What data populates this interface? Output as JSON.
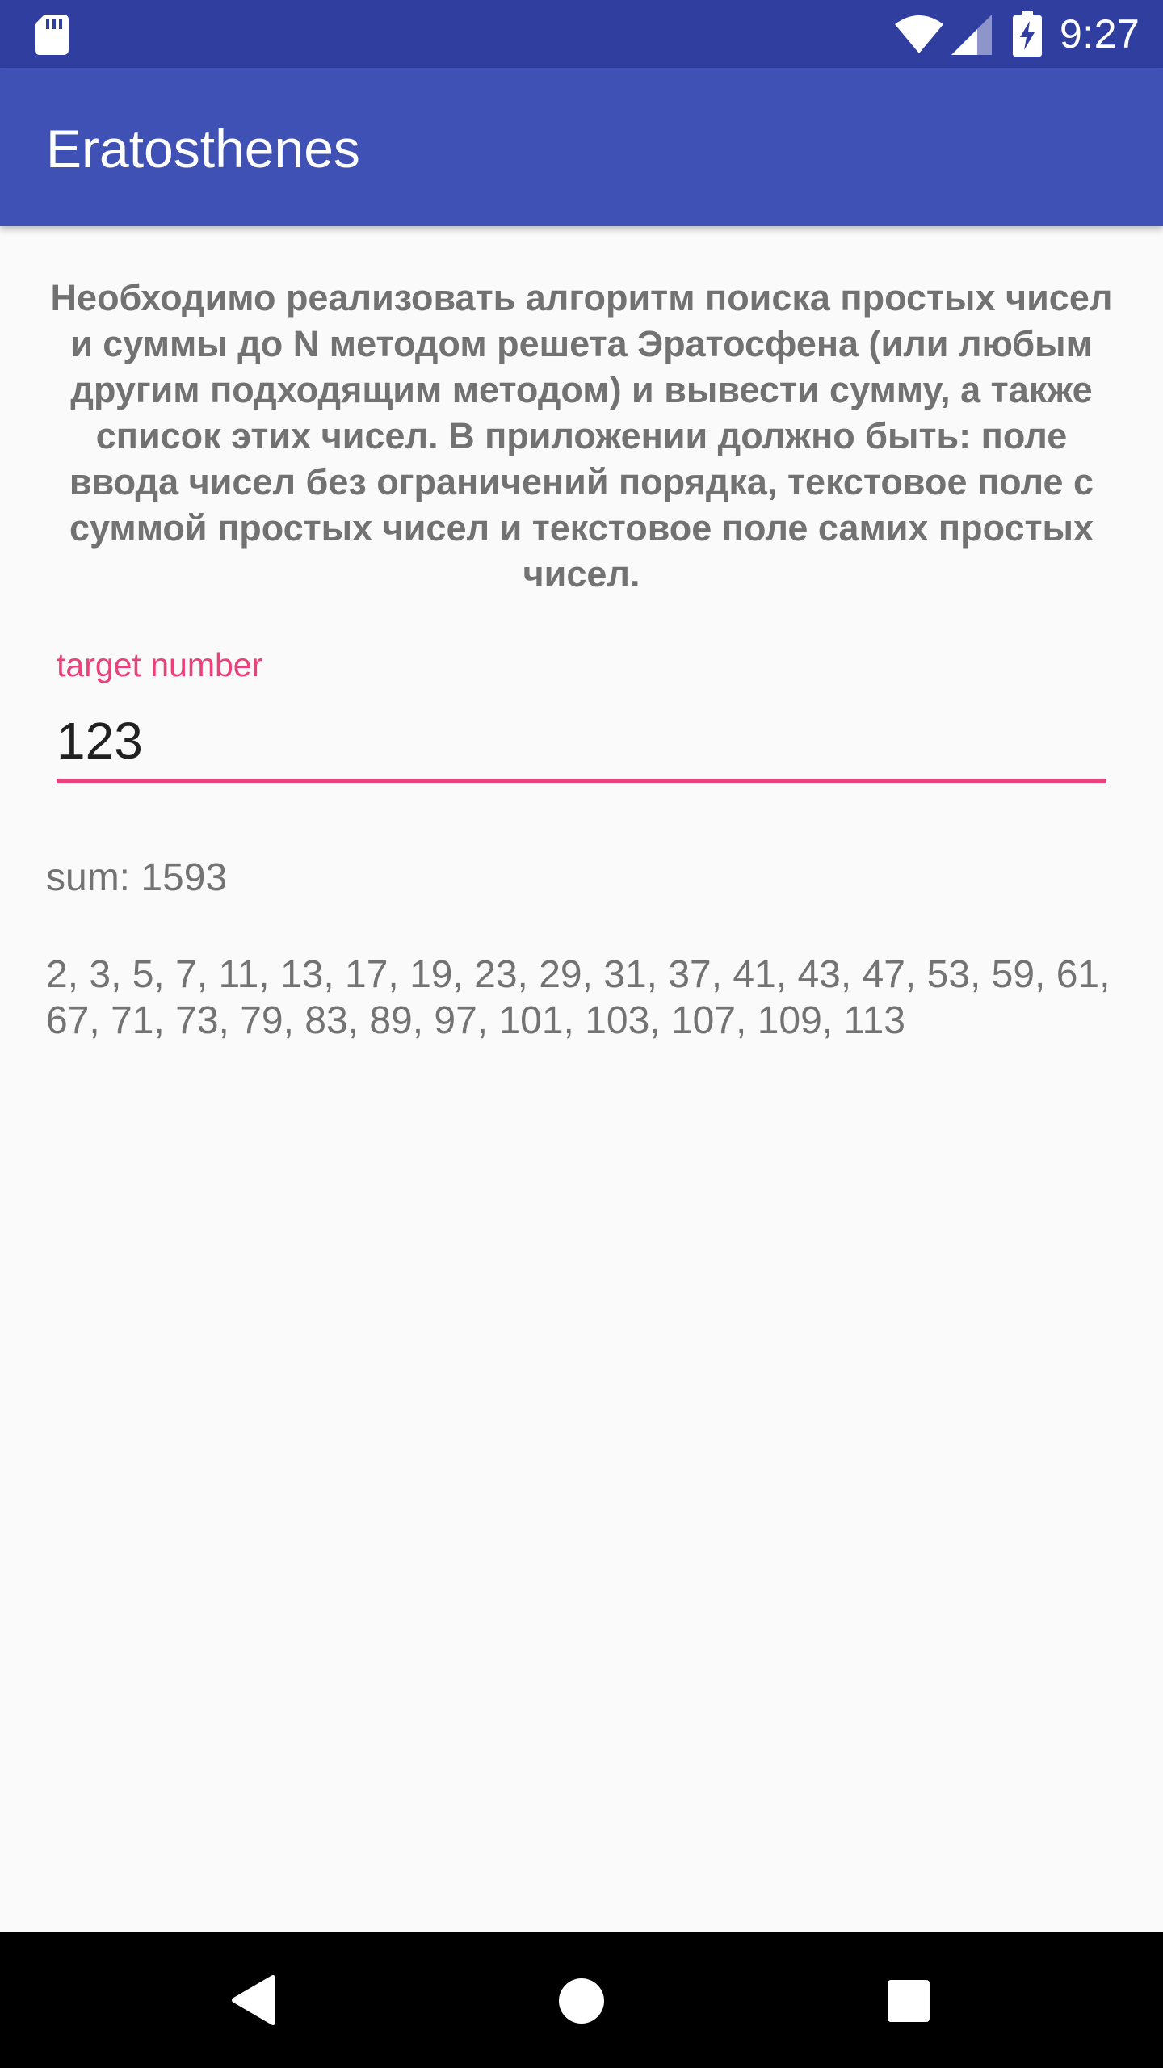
{
  "status_bar": {
    "time": "9:27",
    "icons": [
      "sd-card-icon",
      "wifi-icon",
      "cell-signal-icon",
      "battery-charging-icon"
    ]
  },
  "app_bar": {
    "title": "Eratosthenes"
  },
  "task": {
    "description": "Необходимо реализовать алгоритм поиска простых чисел и суммы до N методом решета Эратосфена (или любым другим подходящим методом) и вывести сумму, а также список этих чисел. В приложении должно быть: поле ввода чисел без ограничений порядка, текстовое поле с суммой простых чисел и текстовое поле самих простых чисел."
  },
  "input": {
    "label": "target number",
    "value": "123"
  },
  "results": {
    "sum": "sum: 1593",
    "primes": "2, 3, 5, 7, 11, 13, 17, 19, 23, 29, 31, 37, 41, 43, 47, 53, 59, 61, 67, 71, 73, 79, 83, 89, 97, 101, 103, 107, 109, 113"
  },
  "nav_bar": {
    "icons": [
      "back-icon",
      "home-icon",
      "recents-icon"
    ]
  },
  "colors": {
    "status_bar": "#303f9f",
    "app_bar": "#3f51b5",
    "accent": "#ec407a",
    "background": "#fafafa",
    "secondary_text": "#737373"
  }
}
